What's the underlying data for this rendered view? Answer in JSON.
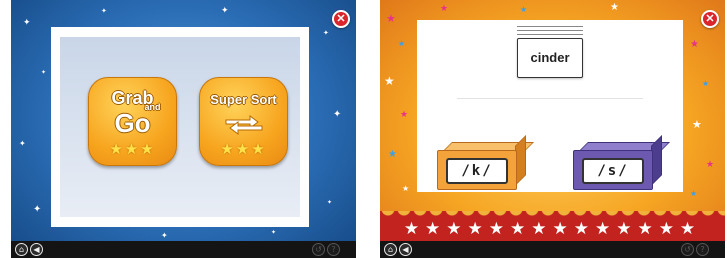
{
  "left_screen": {
    "games": [
      {
        "title_line1": "Grab",
        "title_line2": "and",
        "title_line3": "Go",
        "stars": "★★★"
      },
      {
        "title": "Super Sort",
        "stars": "★★★"
      }
    ],
    "close_symbol": "✕",
    "bottom_bar": {
      "home_icon": "⌂",
      "sound_icon": "◀",
      "undo_icon": "↺",
      "help_icon": "?"
    }
  },
  "right_screen": {
    "word_card": "cinder",
    "sound_boxes": [
      {
        "label": "/k/",
        "color": "#f3a33a"
      },
      {
        "label": "/s/",
        "color": "#6d5ab0"
      }
    ],
    "close_symbol": "✕",
    "curtain_stars": "★★★★★★★★★★★★★★",
    "bottom_bar": {
      "home_icon": "⌂",
      "sound_icon": "◀",
      "undo_icon": "↺",
      "help_icon": "?"
    }
  }
}
